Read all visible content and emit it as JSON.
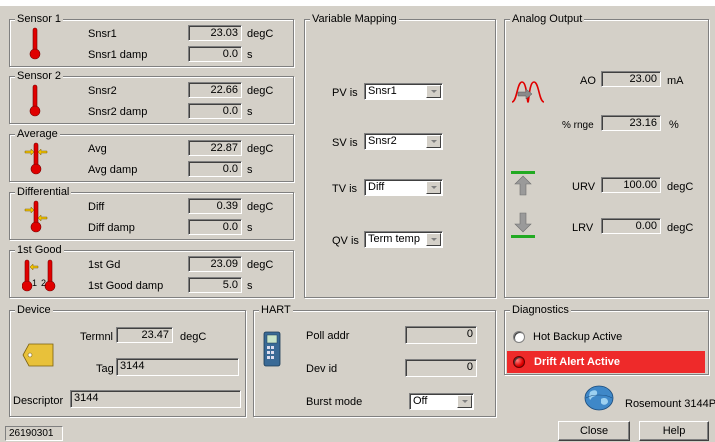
{
  "sensor1": {
    "title": "Sensor 1",
    "rows": [
      {
        "label": "Snsr1",
        "value": "23.03",
        "unit": "degC"
      },
      {
        "label": "Snsr1 damp",
        "value": "0.0",
        "unit": "s"
      }
    ]
  },
  "sensor2": {
    "title": "Sensor 2",
    "rows": [
      {
        "label": "Snsr2",
        "value": "22.66",
        "unit": "degC"
      },
      {
        "label": "Snsr2 damp",
        "value": "0.0",
        "unit": "s"
      }
    ]
  },
  "average": {
    "title": "Average",
    "rows": [
      {
        "label": "Avg",
        "value": "22.87",
        "unit": "degC"
      },
      {
        "label": "Avg damp",
        "value": "0.0",
        "unit": "s"
      }
    ]
  },
  "differential": {
    "title": "Differential",
    "rows": [
      {
        "label": "Diff",
        "value": "0.39",
        "unit": "degC"
      },
      {
        "label": "Diff damp",
        "value": "0.0",
        "unit": "s"
      }
    ]
  },
  "first_good": {
    "title": "1st Good",
    "rows": [
      {
        "label": "1st Gd",
        "value": "23.09",
        "unit": "degC"
      },
      {
        "label": "1st Good damp",
        "value": "5.0",
        "unit": "s"
      }
    ],
    "icon_labels": [
      "1",
      "2"
    ]
  },
  "variable_mapping": {
    "title": "Variable Mapping",
    "rows": [
      {
        "label": "PV is",
        "value": "Snsr1"
      },
      {
        "label": "SV is",
        "value": "Snsr2"
      },
      {
        "label": "TV is",
        "value": "Diff"
      },
      {
        "label": "QV is",
        "value": "Term temp"
      }
    ]
  },
  "analog_output": {
    "title": "Analog Output",
    "ao": {
      "label": "AO",
      "value": "23.00",
      "unit": "mA"
    },
    "pct_range": {
      "label": "% rnge",
      "value": "23.16",
      "unit": "%"
    },
    "urv": {
      "label": "URV",
      "value": "100.00",
      "unit": "degC"
    },
    "lrv": {
      "label": "LRV",
      "value": "0.00",
      "unit": "degC"
    }
  },
  "device": {
    "title": "Device",
    "terminal": {
      "label": "Termnl",
      "value": "23.47",
      "unit": "degC"
    },
    "tag": {
      "label": "Tag",
      "value": "3144"
    },
    "descriptor": {
      "label": "Descriptor",
      "value": "3144"
    }
  },
  "hart": {
    "title": "HART",
    "poll_addr": {
      "label": "Poll addr",
      "value": "0"
    },
    "dev_id": {
      "label": "Dev id",
      "value": "0"
    },
    "burst_mode": {
      "label": "Burst mode",
      "value": "Off"
    }
  },
  "diagnostics": {
    "title": "Diagnostics",
    "hot_backup": "Hot Backup Active",
    "drift_alert": "Drift Alert Active"
  },
  "product_name": "Rosemount 3144P",
  "buttons": {
    "close": "Close",
    "help": "Help"
  },
  "status_bar": "26190301",
  "colors": {
    "alert_red": "#ee2a2a",
    "thermo_red": "#e00000",
    "range_green": "#22aa22",
    "arrow_gray": "#9a9a9a"
  }
}
